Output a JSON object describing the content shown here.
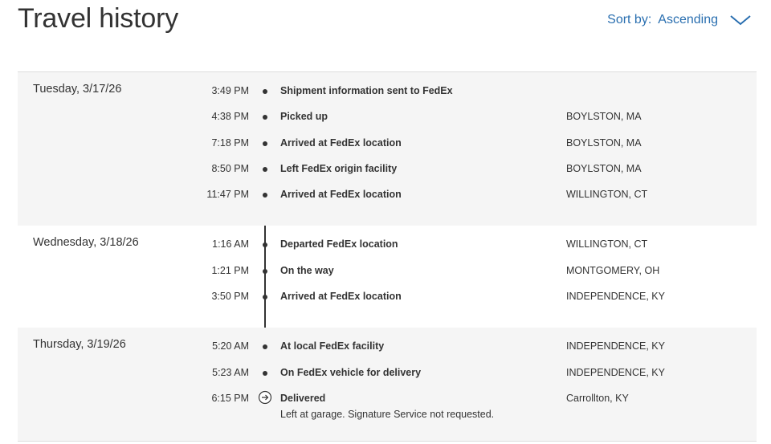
{
  "header": {
    "title": "Travel history",
    "sort_label": "Sort by:",
    "sort_value": "Ascending"
  },
  "days": [
    {
      "date": "Tuesday, 3/17/26",
      "events": [
        {
          "time": "3:49 PM",
          "desc": "Shipment information sent to FedEx",
          "loc": ""
        },
        {
          "time": "4:38 PM",
          "desc": "Picked up",
          "loc": "BOYLSTON, MA"
        },
        {
          "time": "7:18 PM",
          "desc": "Arrived at FedEx location",
          "loc": "BOYLSTON, MA"
        },
        {
          "time": "8:50 PM",
          "desc": "Left FedEx origin facility",
          "loc": "BOYLSTON, MA"
        },
        {
          "time": "11:47 PM",
          "desc": "Arrived at FedEx location",
          "loc": "WILLINGTON, CT"
        }
      ]
    },
    {
      "date": "Wednesday, 3/18/26",
      "events": [
        {
          "time": "1:16 AM",
          "desc": "Departed FedEx location",
          "loc": "WILLINGTON, CT"
        },
        {
          "time": "1:21 PM",
          "desc": "On the way",
          "loc": "MONTGOMERY, OH"
        },
        {
          "time": "3:50 PM",
          "desc": "Arrived at FedEx location",
          "loc": "INDEPENDENCE, KY"
        }
      ]
    },
    {
      "date": "Thursday, 3/19/26",
      "events": [
        {
          "time": "5:20 AM",
          "desc": "At local FedEx facility",
          "loc": "INDEPENDENCE, KY"
        },
        {
          "time": "5:23 AM",
          "desc": "On FedEx vehicle for delivery",
          "loc": "INDEPENDENCE, KY"
        },
        {
          "time": "6:15 PM",
          "desc": "Delivered",
          "loc": "Carrollton, KY",
          "note": "Left at garage. Signature Service not requested."
        }
      ]
    }
  ],
  "colors": {
    "link": "#2a6fb0",
    "text": "#333333",
    "shaded_row": "#f5f5f5"
  },
  "icons": {
    "sort": "chevron-down-icon",
    "delivered": "arrow-circle-right-icon",
    "event": "timeline-dot-icon"
  }
}
